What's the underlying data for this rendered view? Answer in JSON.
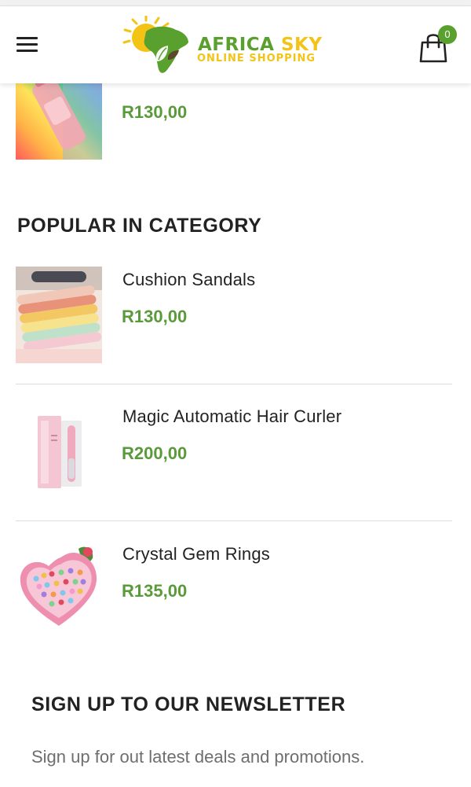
{
  "header": {
    "brand_word_1": "AFRICA",
    "brand_word_2": "SKY",
    "tagline": "ONLINE SHOPPING",
    "cart_count": "0"
  },
  "previous_product": {
    "price": "R130,00"
  },
  "popular": {
    "title": "POPULAR IN CATEGORY",
    "items": [
      {
        "name": "Cushion Sandals",
        "price": "R130,00"
      },
      {
        "name": "Magic Automatic Hair Curler",
        "price": "R200,00"
      },
      {
        "name": "Crystal Gem Rings",
        "price": "R135,00"
      }
    ]
  },
  "newsletter": {
    "title": "SIGN UP TO OUR NEWSLETTER",
    "text": "Sign up for out latest deals and promotions."
  },
  "colors": {
    "brand_green": "#5aa02f",
    "brand_yellow": "#f3c316",
    "price_green": "#5a9a3a"
  }
}
